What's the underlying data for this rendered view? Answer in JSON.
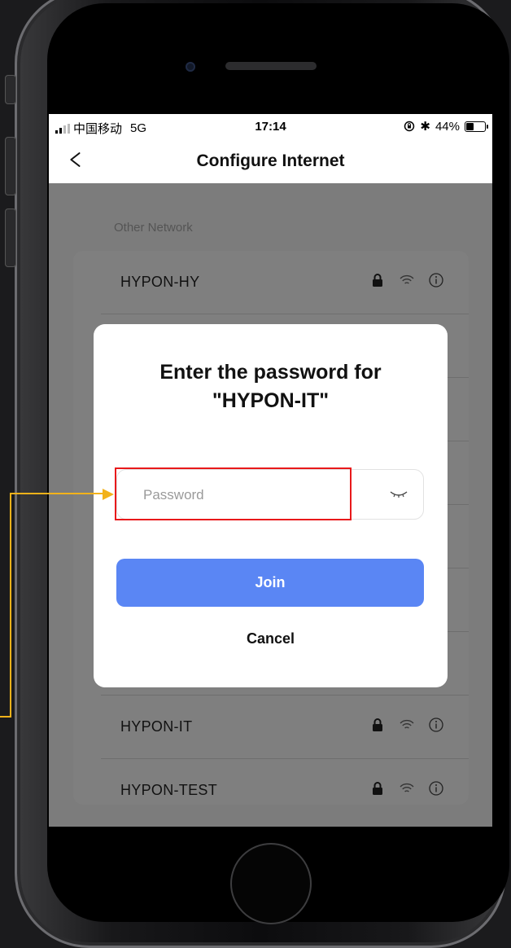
{
  "status_bar": {
    "carrier": "中国移动",
    "network": "5G",
    "time": "17:14",
    "bluetooth": "✱",
    "battery_percent_text": "44%",
    "battery_level": 0.44
  },
  "nav": {
    "title": "Configure Internet"
  },
  "section_label": "Other Network",
  "networks": [
    {
      "name": "HYPON-HY"
    },
    {
      "name": "HYPON-IT"
    },
    {
      "name": "HYPON-TEST"
    }
  ],
  "dialog": {
    "title_line1": "Enter the password for",
    "title_line2": "\"HYPON-IT\"",
    "password_placeholder": "Password",
    "join_label": "Join",
    "cancel_label": "Cancel"
  },
  "colors": {
    "accent": "#5a86f4",
    "highlight": "#e8191b",
    "annotation": "#f2b21a"
  },
  "icons": [
    "lock-icon",
    "wifi-icon",
    "info-icon",
    "back-chevron-icon",
    "eye-closed-icon"
  ]
}
